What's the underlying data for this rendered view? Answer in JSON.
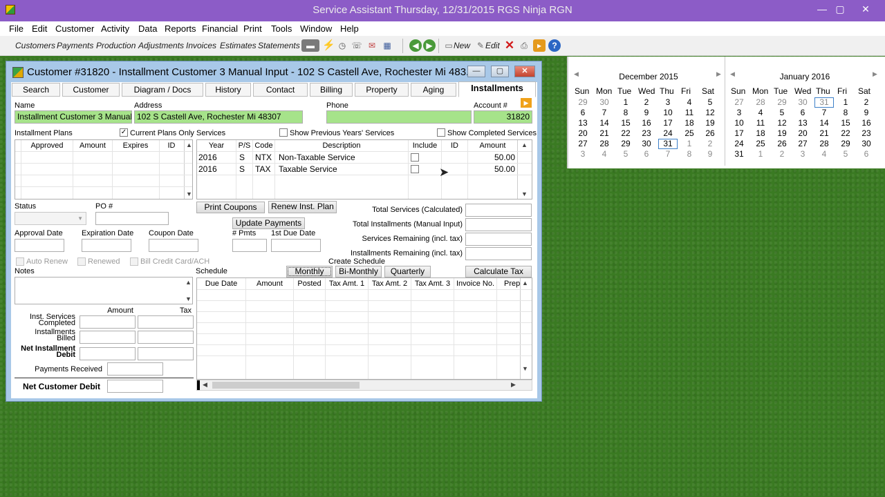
{
  "titlebar": {
    "title": "Service Assistant   Thursday, 12/31/2015   RGS Ninja   RGN",
    "minimize": "—",
    "maximize": "▢",
    "close": "✕"
  },
  "menu": [
    "File",
    "Edit",
    "Customer",
    "Activity",
    "Data",
    "Reports",
    "Financial",
    "Print",
    "Tools",
    "Window",
    "Help"
  ],
  "toolbar": {
    "links": [
      "Customers",
      "Payments",
      "Production",
      "Adjustments",
      "Invoices",
      "Estimates",
      "Statements"
    ],
    "new_label": "New",
    "edit_label": "Edit"
  },
  "calendar": {
    "dow": [
      "Sun",
      "Mon",
      "Tue",
      "Wed",
      "Thu",
      "Fri",
      "Sat"
    ],
    "months": [
      {
        "title": "December 2015",
        "weeks": [
          [
            29,
            30,
            1,
            2,
            3,
            4,
            5
          ],
          [
            6,
            7,
            8,
            9,
            10,
            11,
            12
          ],
          [
            13,
            14,
            15,
            16,
            17,
            18,
            19
          ],
          [
            20,
            21,
            22,
            23,
            24,
            25,
            26
          ],
          [
            27,
            28,
            29,
            30,
            31,
            1,
            2
          ],
          [
            3,
            4,
            5,
            6,
            7,
            8,
            9
          ]
        ]
      },
      {
        "title": "January 2016",
        "weeks": [
          [
            27,
            28,
            29,
            30,
            31,
            1,
            2
          ],
          [
            3,
            4,
            5,
            6,
            7,
            8,
            9
          ],
          [
            10,
            11,
            12,
            13,
            14,
            15,
            16
          ],
          [
            17,
            18,
            19,
            20,
            21,
            22,
            23
          ],
          [
            24,
            25,
            26,
            27,
            28,
            29,
            30
          ],
          [
            31,
            1,
            2,
            3,
            4,
            5,
            6
          ]
        ]
      }
    ]
  },
  "window": {
    "title": "Customer #31820 - Installment Customer 3 Manual Input - 102 S Castell Ave, Rochester Mi 483..."
  },
  "tabs": [
    "Search",
    "Customer",
    "Diagram / Docs",
    "History",
    "Contact",
    "Billing",
    "Property",
    "Aging",
    "Installments"
  ],
  "customer": {
    "name_label": "Name",
    "name": "Installment Customer 3 Manual Input",
    "address_label": "Address",
    "address": "102 S Castell Ave, Rochester Mi 48307",
    "phone_label": "Phone",
    "phone": "",
    "account_label": "Account #",
    "account": "31820"
  },
  "plans": {
    "label": "Installment Plans",
    "current_only": "Current Plans Only",
    "columns": [
      "Approved",
      "Amount",
      "Expires",
      "ID"
    ]
  },
  "services": {
    "label": "Services",
    "show_prev": "Show Previous Years' Services",
    "show_completed": "Show Completed Services",
    "columns": [
      "Year",
      "P/S",
      "Code",
      "Description",
      "Include",
      "ID",
      "Amount"
    ],
    "rows": [
      [
        "2016",
        "S",
        "NTX",
        "Non-Taxable Service",
        "",
        "",
        "50.00"
      ],
      [
        "2016",
        "S",
        "TAX",
        "Taxable Service",
        "",
        "",
        "50.00"
      ]
    ]
  },
  "form": {
    "status": "Status",
    "po": "PO #",
    "approval_date": "Approval Date",
    "expiration_date": "Expiration Date",
    "coupon_date": "Coupon Date",
    "pmts": "# Pmts",
    "first_due": "1st Due Date",
    "auto_renew": "Auto Renew",
    "renewed": "Renewed",
    "bill_cc": "Bill Credit Card/ACH",
    "notes": "Notes",
    "print_coupons": "Print Coupons",
    "renew_plan": "Renew Inst. Plan",
    "update_payments": "Update Payments",
    "total_services": "Total Services (Calculated)",
    "total_installments": "Total Installments (Manual Input)",
    "services_remaining": "Services Remaining (incl. tax)",
    "installments_remaining": "Installments Remaining (incl. tax)"
  },
  "schedule": {
    "label": "Schedule",
    "create": "Create Schedule",
    "monthly": "Monthly",
    "bimonthly": "Bi-Monthly",
    "quarterly": "Quarterly",
    "calc_tax": "Calculate Tax",
    "columns": [
      "Due Date",
      "Amount",
      "Posted",
      "Tax Amt. 1",
      "Tax Amt. 2",
      "Tax Amt. 3",
      "Invoice No.",
      "Prep"
    ]
  },
  "summary": {
    "amount": "Amount",
    "tax": "Tax",
    "inst_completed_1": "Inst. Services",
    "inst_completed_2": "Completed",
    "inst_billed_1": "Installments",
    "inst_billed_2": "Billed",
    "net_debit_1": "Net Installment",
    "net_debit_2": "Debit",
    "payments_received": "Payments Received",
    "net_customer_debit": "Net Customer Debit"
  }
}
